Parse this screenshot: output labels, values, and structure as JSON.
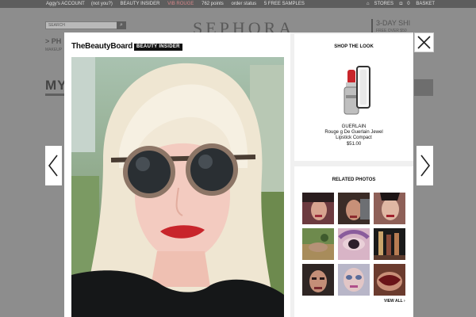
{
  "topbar": {
    "account": "Aggy's ACCOUNT",
    "not_you": "(not you?)",
    "beauty_insider": "BEAUTY INSIDER",
    "vib_rouge": "VIB ROUGE",
    "points": "762 points",
    "order_status": "order status",
    "samples": "5 FREE SAMPLES",
    "stores": "STORES",
    "basket_count": "0",
    "basket": "BASKET"
  },
  "background": {
    "search_placeholder": "SEARCH",
    "logo": "SEPHORA",
    "promo_title": "3-DAY SHI",
    "promo_sub": "FREE OVER $50",
    "crumb": "> PH",
    "makeup": "MAKEUP",
    "my": "MY"
  },
  "modal": {
    "brand": "TheBeautyBoard",
    "badge": "BEAUTY INSIDER",
    "shop_the_look": "SHOP THE LOOK",
    "product": {
      "brand": "GUERLAIN",
      "name_line1": "Rouge g De Guerlain Jewel",
      "name_line2": "Lipstick Compact",
      "price": "$51.00"
    },
    "related_photos": "RELATED PHOTOS",
    "view_all": "VIEW ALL ›"
  },
  "colors": {
    "overlay": "#8f8f8f",
    "topbar": "#5d5d5d",
    "lipstick": "#c8252b",
    "hair": "#f2ead8"
  },
  "icons": {
    "close": "close-icon",
    "prev": "chevron-left-icon",
    "next": "chevron-right-icon",
    "search": "search-icon",
    "stores": "store-icon",
    "basket": "basket-icon"
  }
}
